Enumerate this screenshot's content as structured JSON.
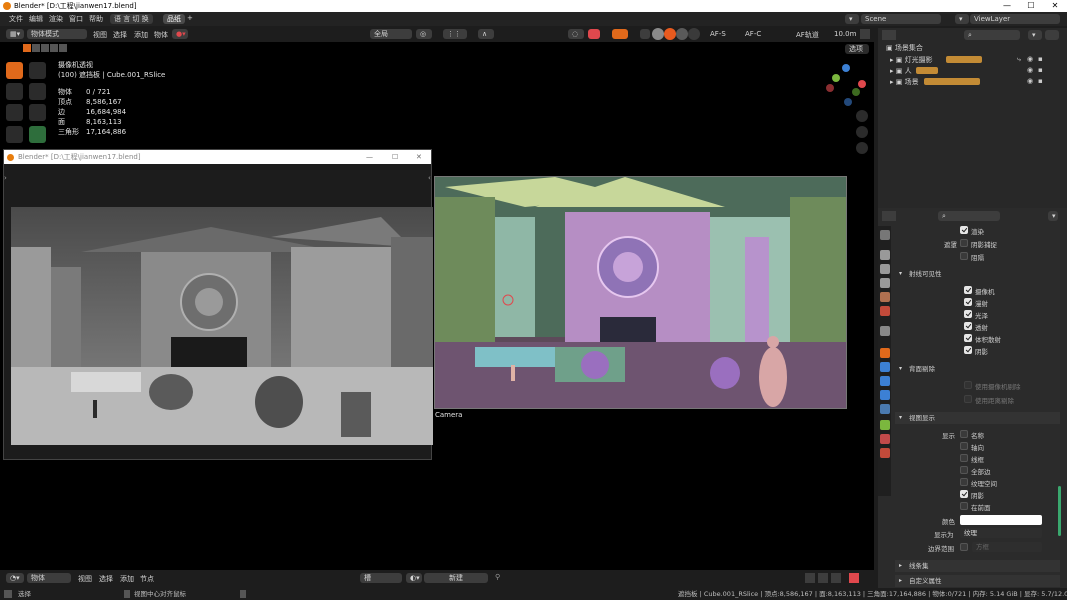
{
  "window": {
    "title": "Blender* [D:\\工程\\jianwen17.blend]"
  },
  "menu": {
    "items": [
      "文件",
      "编辑",
      "渲染",
      "窗口",
      "帮助"
    ],
    "lang_button": "语 言 切 换",
    "workspace_tab": "品纸",
    "add_tab": "+",
    "scene": "Scene",
    "view_layer": "ViewLayer"
  },
  "viewport_header": {
    "mode": "物体模式",
    "menus": [
      "视图",
      "选择",
      "添加",
      "物体"
    ],
    "transform": "全局",
    "af_s": "AF-S",
    "af_c": "AF-C",
    "af_track": "AF轨道",
    "focal": "10.0m",
    "options": "选项"
  },
  "stats": {
    "view_name": "摄像机透视",
    "collection": "(100) 遮挡板 | Cube.001_RSlice",
    "rows": [
      {
        "label": "物体",
        "value": "0 / 721"
      },
      {
        "label": "顶点",
        "value": "8,586,167"
      },
      {
        "label": "边",
        "value": "16,684,984"
      },
      {
        "label": "面",
        "value": "8,163,113"
      },
      {
        "label": "三角形",
        "value": "17,164,886"
      }
    ]
  },
  "render_window": {
    "title": "Blender* [D:\\工程\\jianwen17.blend]"
  },
  "camera_label": "Camera",
  "outliner": {
    "root": "场景集合",
    "items": [
      "灯光摄影",
      "人",
      "场景"
    ]
  },
  "properties": {
    "visibility": {
      "render": "渲染",
      "shadow_catcher_label": "遮罩",
      "shadow_catcher": "阴影捕捉",
      "holdout": "阻隔"
    },
    "ray_visibility": {
      "title": "射线可见性",
      "items": [
        "摄像机",
        "漫射",
        "光泽",
        "透射",
        "体积散射",
        "阴影"
      ]
    },
    "culling": {
      "title": "背面剔除",
      "items": [
        "使用摄像机剔除",
        "使用距离剔除"
      ]
    },
    "viewport_display": {
      "title": "视图显示",
      "show_label": "显示",
      "items": [
        "名称",
        "轴向",
        "线框",
        "全部边",
        "纹理空间",
        "阴影",
        "在前面"
      ],
      "color_label": "颜色",
      "display_as_label": "显示为",
      "display_as": "纹理",
      "bounds_label": "边界范围",
      "bounds_value": "方框"
    },
    "collapsed": [
      "线条集",
      "自定义属性"
    ]
  },
  "bottom_bar": {
    "mode": "物体",
    "menus": [
      "视图",
      "选择",
      "添加",
      "节点"
    ],
    "slot": "槽",
    "new_button": "新建"
  },
  "status_bar": {
    "left": "选择",
    "middle": "视图中心对齐鼠标",
    "right": "遮挡板 | Cube.001_RSlice | 顶点:8,586,167 | 面:8,163,113 | 三角面:17,164,886 | 物体:0/721 | 内存: 5.14 GiB | 显存: 5.7/12.0 GiB | 3.5.1"
  },
  "colors": {
    "accent": "#e0691b",
    "axis_x": "#e0484d",
    "axis_y": "#7bb73e",
    "axis_z": "#3c80d4"
  }
}
